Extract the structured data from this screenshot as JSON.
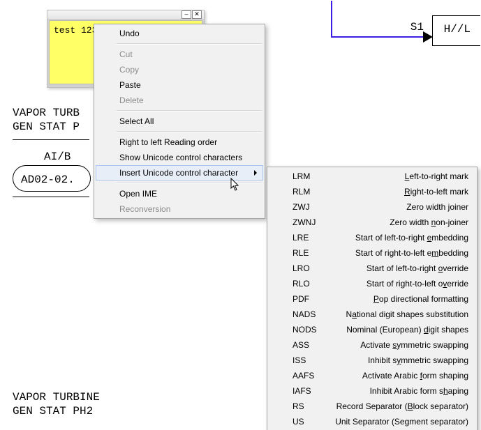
{
  "background": {
    "block1_line1": "VAPOR TURB",
    "block1_line2": "GEN STAT P",
    "ai_label": "AI/B",
    "node_label": "AD02-02.",
    "block2_line1": "VAPOR TURBINE",
    "block2_line2": "GEN STAT PH2",
    "s1": "S1",
    "hl": "H//L"
  },
  "note": {
    "text": "test 123",
    "minimize_glyph": "–",
    "close_glyph": "✕"
  },
  "context_menu": {
    "undo": "Undo",
    "cut": "Cut",
    "copy": "Copy",
    "paste": "Paste",
    "delete": "Delete",
    "select_all": "Select All",
    "rtl": "Right to left Reading order",
    "show_ucc": "Show Unicode control characters",
    "insert_ucc": "Insert Unicode control character",
    "open_ime": "Open IME",
    "reconversion": "Reconversion"
  },
  "submenu": [
    {
      "code": "LRM",
      "desc_pre": "",
      "u": "L",
      "desc_post": "eft-to-right mark"
    },
    {
      "code": "RLM",
      "desc_pre": "",
      "u": "R",
      "desc_post": "ight-to-left mark"
    },
    {
      "code": "ZWJ",
      "desc_pre": "Zero width ",
      "u": "j",
      "desc_post": "oiner"
    },
    {
      "code": "ZWNJ",
      "desc_pre": "Zero width ",
      "u": "n",
      "desc_post": "on-joiner"
    },
    {
      "code": "LRE",
      "desc_pre": "Start of left-to-right ",
      "u": "e",
      "desc_post": "mbedding"
    },
    {
      "code": "RLE",
      "desc_pre": "Start of right-to-left e",
      "u": "m",
      "desc_post": "bedding"
    },
    {
      "code": "LRO",
      "desc_pre": "Start of left-to-right ",
      "u": "o",
      "desc_post": "verride"
    },
    {
      "code": "RLO",
      "desc_pre": "Start of right-to-left o",
      "u": "v",
      "desc_post": "erride"
    },
    {
      "code": "PDF",
      "desc_pre": "",
      "u": "P",
      "desc_post": "op directional formatting"
    },
    {
      "code": "NADS",
      "desc_pre": "N",
      "u": "a",
      "desc_post": "tional digit shapes substitution"
    },
    {
      "code": "NODS",
      "desc_pre": "Nominal (European) ",
      "u": "d",
      "desc_post": "igit shapes"
    },
    {
      "code": "ASS",
      "desc_pre": "Activate ",
      "u": "s",
      "desc_post": "ymmetric swapping"
    },
    {
      "code": "ISS",
      "desc_pre": "Inhibit s",
      "u": "y",
      "desc_post": "mmetric swapping"
    },
    {
      "code": "AAFS",
      "desc_pre": "Activate Arabic ",
      "u": "f",
      "desc_post": "orm shaping"
    },
    {
      "code": "IAFS",
      "desc_pre": "Inhibit Arabic form s",
      "u": "h",
      "desc_post": "aping"
    },
    {
      "code": "RS",
      "desc_pre": "Record Separator (",
      "u": "B",
      "desc_post": "lock separator)"
    },
    {
      "code": "US",
      "desc_pre": "Unit Separator (Se",
      "u": "g",
      "desc_post": "ment separator)"
    }
  ]
}
